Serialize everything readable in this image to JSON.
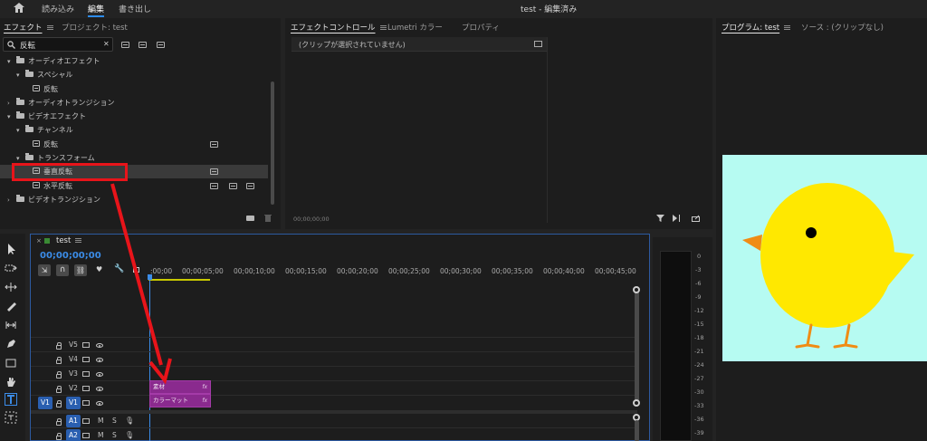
{
  "menubar": {
    "import_label": "読み込み",
    "edit_label": "編集",
    "export_label": "書き出し",
    "title": "test - 編集済み"
  },
  "effects_panel": {
    "tab_effects": "エフェクト",
    "tab_project": "プロジェクト: test",
    "search_value": "反転",
    "search_clear": "✕",
    "tree": [
      {
        "label": "オーディオエフェクト"
      },
      {
        "label": "スペシャル"
      },
      {
        "label": "反転"
      },
      {
        "label": "オーディオトランジション"
      },
      {
        "label": "ビデオエフェクト"
      },
      {
        "label": "チャンネル"
      },
      {
        "label": "反転"
      },
      {
        "label": "トランスフォーム"
      },
      {
        "label": "垂直反転"
      },
      {
        "label": "水平反転"
      },
      {
        "label": "ビデオトランジション"
      }
    ]
  },
  "effect_controls": {
    "tab_effect_controls": "エフェクトコントロール",
    "tab_lumetri": "Lumetri カラー",
    "tab_properties": "プロパティ",
    "no_clip": "(クリップが選択されていません)",
    "timecode": "00;00;00;00"
  },
  "program_monitor": {
    "tab_program": "プログラム: test",
    "tab_source": "ソース : (クリップなし)"
  },
  "timeline": {
    "sequence_name": "test",
    "timecode": "00;00;00;00",
    "ruler": [
      ":00;00",
      "00;00;05;00",
      "00;00;10;00",
      "00;00;15;00",
      "00;00;20;00",
      "00;00;25;00",
      "00;00;30;00",
      "00;00;35;00",
      "00;00;40;00",
      "00;00;45;00"
    ],
    "video_tracks": [
      "V5",
      "V4",
      "V3",
      "V2",
      "V1"
    ],
    "audio_tracks": [
      "A1",
      "A2"
    ],
    "source_patch_video": "V1",
    "mute_label": "M",
    "solo_label": "S",
    "clips": [
      {
        "label": "素材",
        "fx": "fx"
      },
      {
        "label": "カラーマット",
        "fx": "fx"
      }
    ]
  },
  "audio_meter": {
    "labels": [
      "0",
      "-3",
      "-6",
      "-9",
      "-12",
      "-15",
      "-18",
      "-21",
      "-24",
      "-27",
      "-30",
      "-33",
      "-36",
      "-39"
    ]
  },
  "colors": {
    "accent_blue": "#2d8ceb",
    "clip_purple": "#8a2a8e",
    "annotation_red": "#e8141a",
    "program_bg": "#b6fbf2",
    "chick_yellow": "#ffe800"
  }
}
